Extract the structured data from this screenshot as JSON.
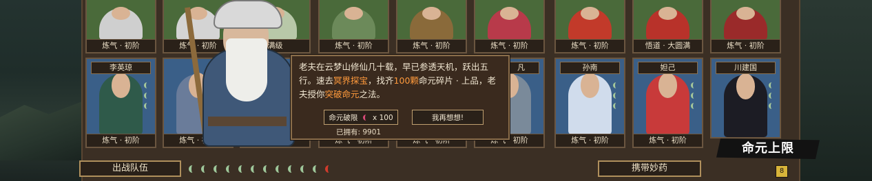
{
  "top_row_ranks": [
    "炼气 · 初阶",
    "炼气 · 初阶",
    "满级",
    "炼气 · 初阶",
    "炼气 · 初阶",
    "炼气 · 初阶",
    "炼气 · 初阶",
    "悟道 · 大圆满",
    "炼气 · 初阶"
  ],
  "second_row": [
    {
      "name": "李英琼",
      "rank": "炼气 · 初阶"
    },
    {
      "name": "",
      "rank": "炼气 · 初阶"
    },
    {
      "name": "",
      "rank": "炼气 · 初阶"
    },
    {
      "name": "",
      "rank": "炼气 · 初阶"
    },
    {
      "name": "",
      "rank": "炼气 · 初阶"
    },
    {
      "name": "凡",
      "rank": "炼气 · 初阶"
    },
    {
      "name": "孙南",
      "rank": "炼气 · 初阶"
    },
    {
      "name": "妲己",
      "rank": "炼气 · 初阶"
    },
    {
      "name": "川建国",
      "rank": ""
    }
  ],
  "dialog": {
    "text_1": "老夫在云梦山修仙几十载，早已参透天机，跃出五行。速去",
    "hl_1": "冥界探宝",
    "text_2": "，找齐",
    "hl_2": "100颗",
    "text_3": "命元碎片 · 上品，老夫授你",
    "hl_3": "突破命元",
    "text_4": "之法。",
    "confirm_label": "命元破限",
    "cost_label": "x 100",
    "cancel_label": "我再想想!",
    "owned_label": "已拥有: 9901"
  },
  "bottom": {
    "team_label": "出战队伍",
    "carry_label": "携带妙药",
    "moons_total": 12,
    "moons_filled": 11
  },
  "banner": {
    "label": "命元上限"
  },
  "key_label": "8"
}
